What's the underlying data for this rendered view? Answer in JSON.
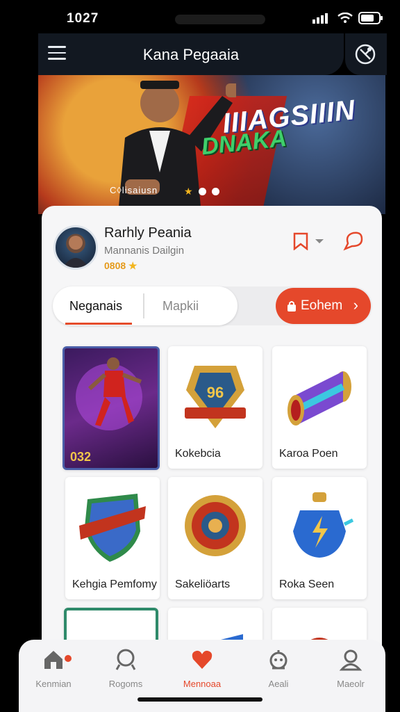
{
  "status": {
    "time": "1027"
  },
  "appbar": {
    "title": "Kana Pegaaia"
  },
  "hero": {
    "title": "IIIAGSIIIN",
    "subtitle": "DNAKA",
    "caption": "C◊lisaiusn"
  },
  "profile": {
    "name": "Rarhly Peania",
    "subtitle": "Mannanis Dailgin",
    "coins": "0808"
  },
  "tabs": {
    "tab1": "Neganais",
    "tab2": "Mapkii",
    "cta": "Eohem"
  },
  "cards": [
    {
      "label": "",
      "number": "032"
    },
    {
      "label": "Kokebcia"
    },
    {
      "label": "Karoa Poen"
    },
    {
      "label": "Kehgia Pemfomy"
    },
    {
      "label": "Sakeliöarts"
    },
    {
      "label": "Roka Seen"
    }
  ],
  "nav": [
    {
      "label": "Kenmian",
      "icon": "home-icon"
    },
    {
      "label": "Rogoms",
      "icon": "search-icon"
    },
    {
      "label": "Mennoaa",
      "icon": "heart-icon"
    },
    {
      "label": "Aeali",
      "icon": "robot-icon"
    },
    {
      "label": "Maeolr",
      "icon": "profile-icon"
    }
  ],
  "colors": {
    "accent": "#e5482b",
    "appbar": "#121821",
    "sheet": "#f6f6f7"
  }
}
